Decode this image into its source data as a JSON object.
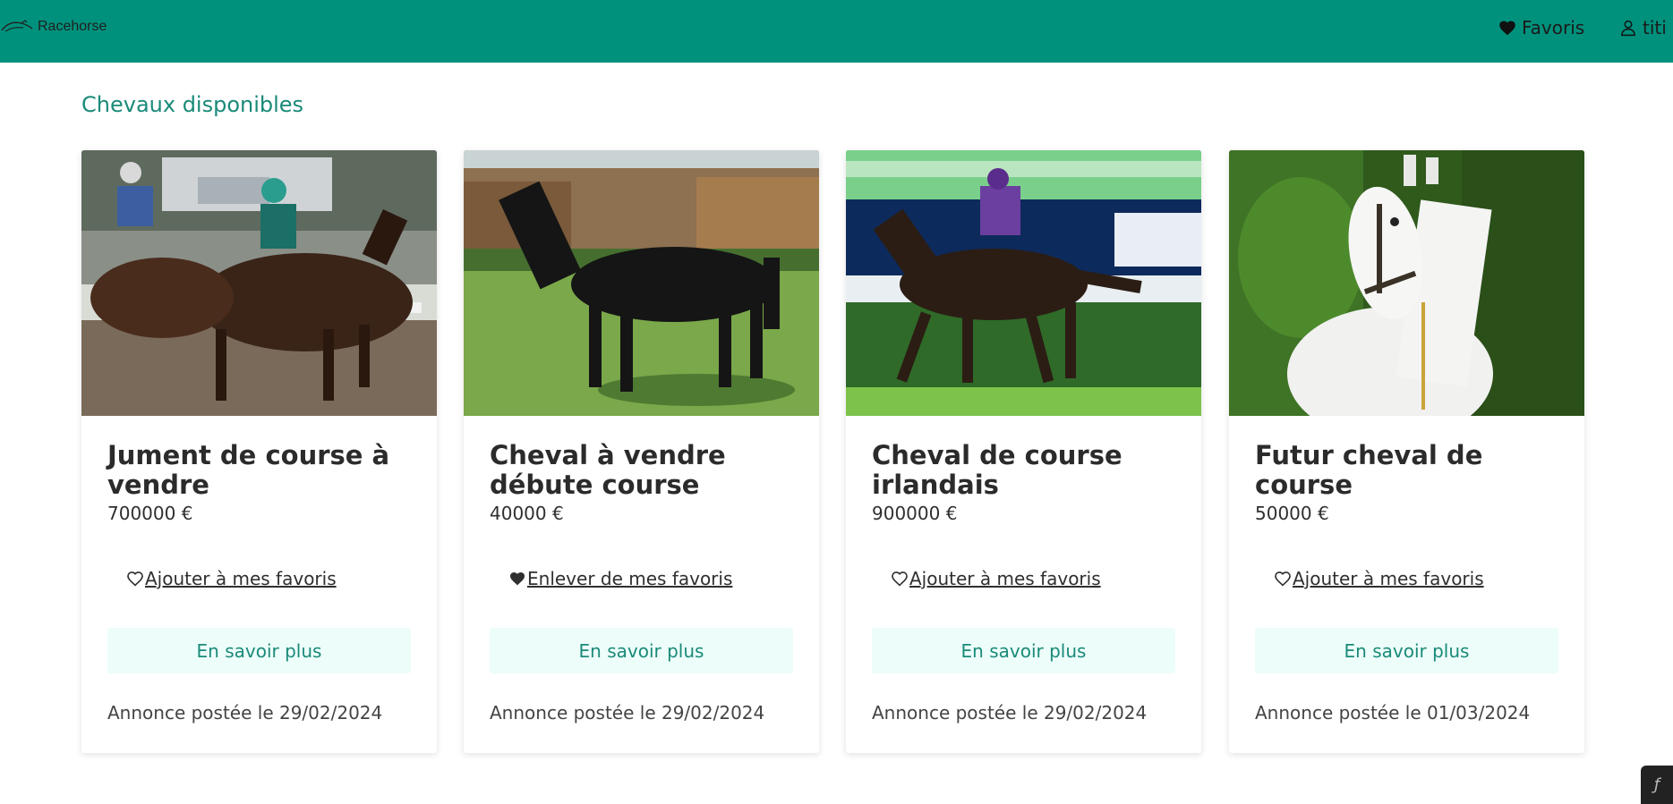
{
  "app": {
    "brand": "Racehorse"
  },
  "nav": {
    "favorites_label": "Favoris",
    "user_label": "titi"
  },
  "page": {
    "title": "Chevaux disponibles"
  },
  "colors": {
    "header": "#00917c",
    "accent_text": "#1a8a78",
    "button_bg": "#ecfdfa"
  },
  "cards": [
    {
      "title": "Jument de course à vendre",
      "price": "700000 €",
      "favorite_label": "Ajouter à mes favoris",
      "favorited": false,
      "more_label": "En savoir plus",
      "posted": "Annonce postée le 29/02/2024",
      "image": "racing-horses-photo"
    },
    {
      "title": "Cheval à vendre débute course",
      "price": "40000 €",
      "favorite_label": "Enlever de mes favoris",
      "favorited": true,
      "more_label": "En savoir plus",
      "posted": "Annonce postée le 29/02/2024",
      "image": "black-horse-in-field-photo"
    },
    {
      "title": "Cheval de course irlandais",
      "price": "900000 €",
      "favorite_label": "Ajouter à mes favoris",
      "favorited": false,
      "more_label": "En savoir plus",
      "posted": "Annonce postée le 29/02/2024",
      "image": "racehorse-jockey-photo"
    },
    {
      "title": "Futur cheval de course",
      "price": "50000 €",
      "favorite_label": "Ajouter à mes favoris",
      "favorited": false,
      "more_label": "En savoir plus",
      "posted": "Annonce postée le 01/03/2024",
      "image": "white-horse-portrait-photo"
    }
  ]
}
